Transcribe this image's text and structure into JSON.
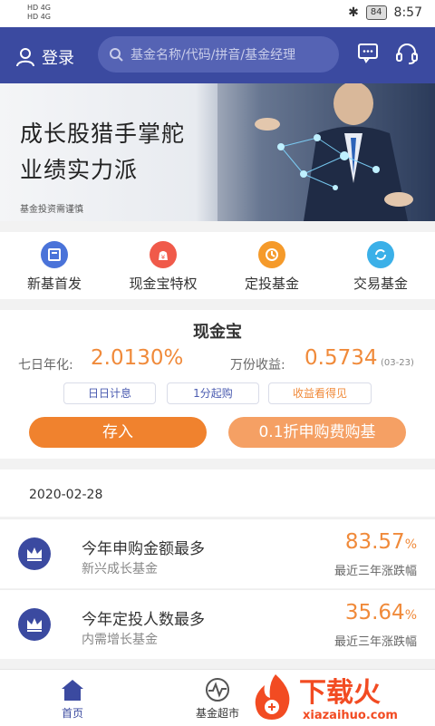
{
  "status": {
    "carrier1": "HD 4G",
    "carrier2": "HD 4G",
    "battery": "84",
    "time": "8:57"
  },
  "header": {
    "login_label": "登录",
    "search_placeholder": "基金名称/代码/拼音/基金经理",
    "message_icon": "chat-bubble-icon",
    "service_icon": "headset-icon"
  },
  "banner": {
    "line1": "成长股猎手掌舵",
    "line2": "业绩实力派",
    "note": "基金投资需谨慎"
  },
  "quick": [
    {
      "label": "新基首发",
      "icon": "new-fund-icon",
      "color": "#4a73d9"
    },
    {
      "label": "现金宝特权",
      "icon": "cash-bag-icon",
      "color": "#f05a4a"
    },
    {
      "label": "定投基金",
      "icon": "clock-icon",
      "color": "#f59a2a"
    },
    {
      "label": "交易基金",
      "icon": "exchange-icon",
      "color": "#3bb0e8"
    }
  ],
  "cash": {
    "title": "现金宝",
    "yield_label": "七日年化:",
    "yield_value": "2.0130%",
    "income_label": "万份收益:",
    "income_value": "0.5734",
    "income_date": "(03-23)",
    "tags": [
      "日日计息",
      "1分起购",
      "收益看得见"
    ],
    "deposit_button": "存入",
    "discount_button": "0.1折申购费购基"
  },
  "date_label": "2020-02-28",
  "rankings": [
    {
      "title": "今年申购金额最多",
      "fund": "新兴成长基金",
      "percent": "83.57",
      "unit": "%",
      "caption": "最近三年涨跌幅"
    },
    {
      "title": "今年定投人数最多",
      "fund": "内需增长基金",
      "percent": "35.64",
      "unit": "%",
      "caption": "最近三年涨跌幅"
    }
  ],
  "tabs": [
    {
      "label": "首页"
    },
    {
      "label": "基金超市"
    }
  ],
  "watermark": {
    "text": "下载火",
    "url": "xiazaihuo.com"
  },
  "colors": {
    "primary": "#3b4aa0",
    "accent": "#f08a3a"
  }
}
